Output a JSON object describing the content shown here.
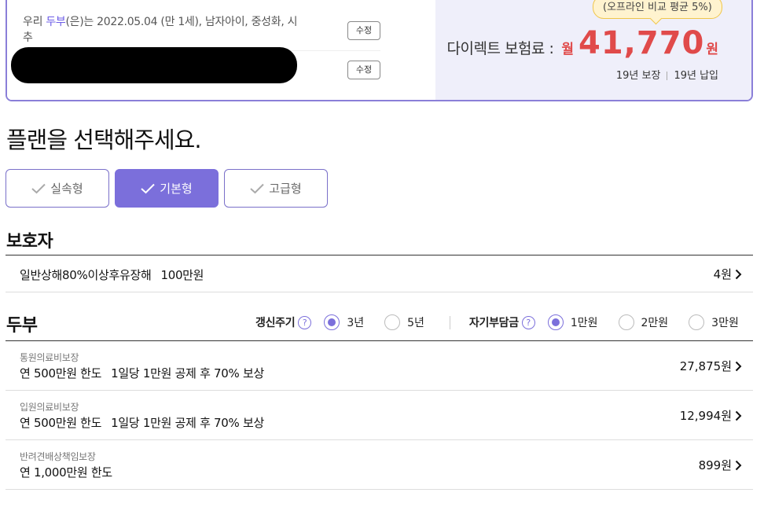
{
  "summary": {
    "pet_prefix": "우리 ",
    "pet_name": "두부",
    "pet_info": "(은)는 2022.05.04 (만 1세), 남자아이, 중성화, 시추",
    "edit_label_1": "수정",
    "edit_label_2": "수정",
    "tooltip": "(오프라인 비교 평균 5%)",
    "premium_label": "다이렉트 보험료 :",
    "premium_unit": "월",
    "premium_amount": "41,770",
    "premium_won": "원",
    "coverage_term": "19년 보장",
    "payment_term": "19년 납입"
  },
  "plan": {
    "title": "플랜을 선택해주세요.",
    "options": [
      {
        "label": "실속형",
        "active": false
      },
      {
        "label": "기본형",
        "active": true
      },
      {
        "label": "고급형",
        "active": false
      }
    ]
  },
  "guardian": {
    "title": "보호자",
    "items": [
      {
        "name": "일반상해80%이상후유장해",
        "amount": "100만원",
        "price": "4원"
      }
    ]
  },
  "pet": {
    "title": "두부",
    "renewal_label": "갱신주기",
    "renewal_options": [
      "3년",
      "5년"
    ],
    "renewal_selected": "3년",
    "deductible_label": "자기부담금",
    "deductible_options": [
      "1만원",
      "2만원",
      "3만원"
    ],
    "deductible_selected": "1만원",
    "help_glyph": "?",
    "items": [
      {
        "category": "통원의료비보장",
        "limit": "연 500만원 한도",
        "detail": "1일당 1만원 공제 후 70% 보상",
        "price": "27,875원"
      },
      {
        "category": "입원의료비보장",
        "limit": "연 500만원 한도",
        "detail": "1일당 1만원 공제 후 70% 보상",
        "price": "12,994원"
      },
      {
        "category": "반려견배상책임보장",
        "limit": "연 1,000만원 한도",
        "detail": "",
        "price": "899원"
      }
    ]
  },
  "colors": {
    "accent": "#7b6fdb",
    "price_red": "#e04a4a",
    "summary_bg": "#efeffa",
    "tooltip_bg": "#fff3cf"
  }
}
